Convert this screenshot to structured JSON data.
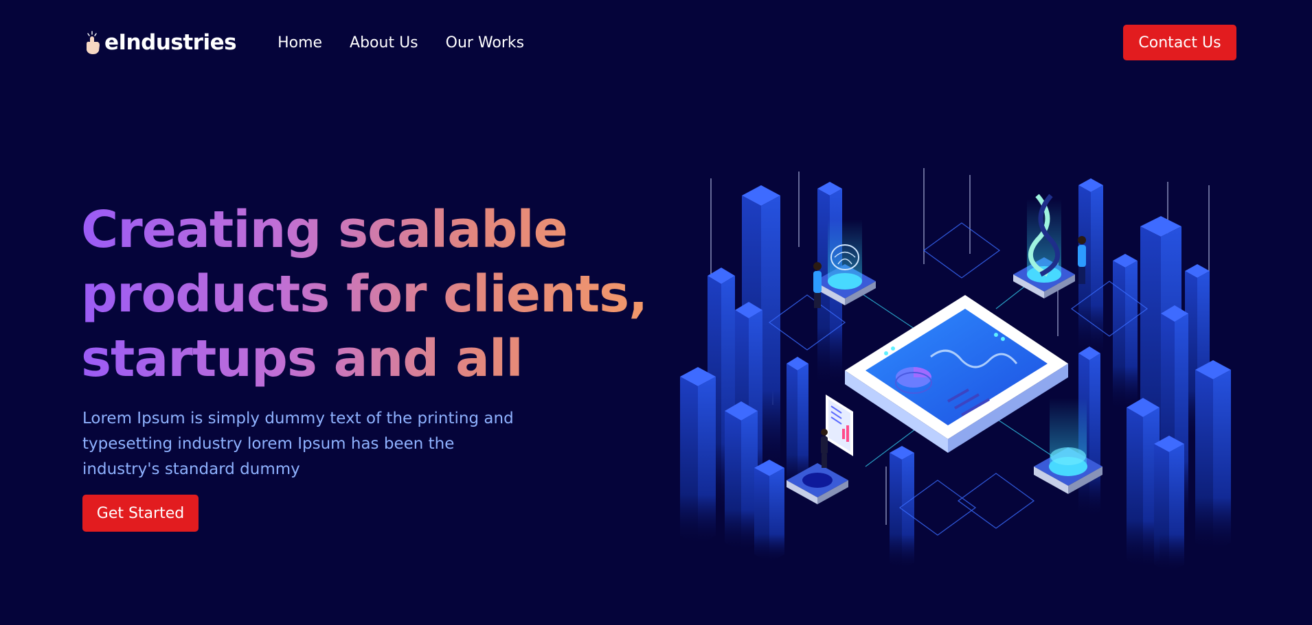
{
  "brand": {
    "name": "eIndustries",
    "icon": "pointing-hand-icon"
  },
  "nav": {
    "items": [
      {
        "label": "Home"
      },
      {
        "label": "About Us"
      },
      {
        "label": "Our Works"
      }
    ],
    "cta_label": "Contact Us"
  },
  "hero": {
    "title_lines": [
      "Creating scalable",
      "products for clients,",
      "startups and all"
    ],
    "description_lines": [
      "Lorem Ipsum is simply dummy text of the printing and",
      "typesetting industry lorem Ipsum has been the",
      "industry's standard dummy"
    ],
    "cta_label": "Get Started"
  },
  "colors": {
    "background": "#05043a",
    "accent_red": "#e21c1f",
    "description_text": "#8fb2ff",
    "title_gradient_start": "#9b5cf6",
    "title_gradient_end": "#f2986a"
  },
  "illustration": {
    "description_icon": "isometric-data-center-icon"
  }
}
